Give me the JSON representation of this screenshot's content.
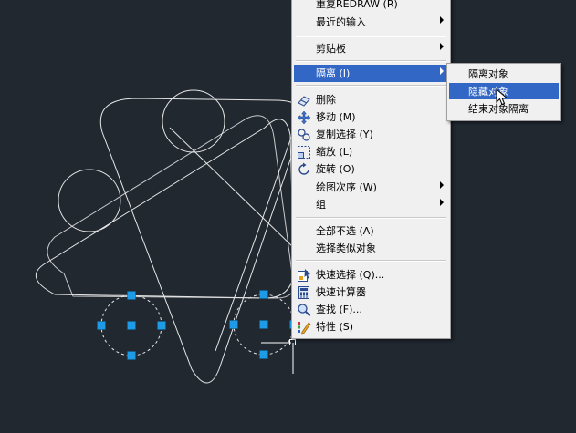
{
  "context_menu": {
    "items": [
      {
        "label": "重复REDRAW (R)"
      },
      {
        "label": "最近的输入"
      },
      {
        "label": "剪贴板"
      },
      {
        "label": "隔离 (I)"
      },
      {
        "label": "删除"
      },
      {
        "label": "移动 (M)"
      },
      {
        "label": "复制选择 (Y)"
      },
      {
        "label": "缩放 (L)"
      },
      {
        "label": "旋转 (O)"
      },
      {
        "label": "绘图次序 (W)"
      },
      {
        "label": "组"
      },
      {
        "label": "全部不选 (A)"
      },
      {
        "label": "选择类似对象"
      },
      {
        "label": "快速选择 (Q)..."
      },
      {
        "label": "快速计算器"
      },
      {
        "label": "查找 (F)..."
      },
      {
        "label": "特性 (S)"
      }
    ]
  },
  "submenu": {
    "items": [
      {
        "label": "隔离对象"
      },
      {
        "label": "隐藏对象"
      },
      {
        "label": "结束对象隔离"
      }
    ]
  },
  "colors": {
    "canvas_bg": "#212830",
    "geometry": "#e6e6e6",
    "grip": "#1e9be6",
    "highlight": "#3267c5"
  }
}
